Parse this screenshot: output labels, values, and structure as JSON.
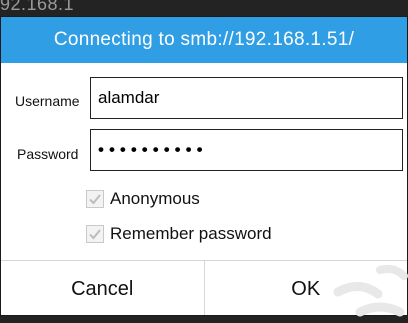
{
  "background_text": "92.168.1",
  "dialog": {
    "title": "Connecting to smb://192.168.1.51/",
    "username_label": "Username",
    "username_value": "alamdar",
    "password_label": "Password",
    "password_mask": "••••••••••",
    "anonymous_label": "Anonymous",
    "anonymous_checked": true,
    "remember_label": "Remember password",
    "remember_checked": true,
    "cancel_label": "Cancel",
    "ok_label": "OK"
  },
  "colors": {
    "title_bar": "#2f9ee4",
    "check_mark": "#bdbdbd"
  }
}
